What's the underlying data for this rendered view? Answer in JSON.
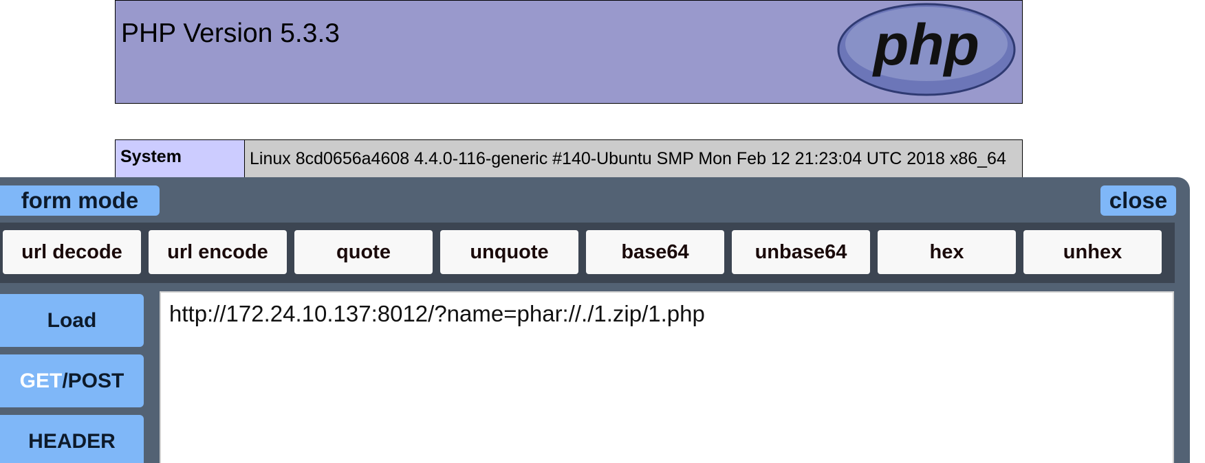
{
  "phpinfo": {
    "title": "PHP Version 5.3.3",
    "logo_text": "php",
    "system_label": "System",
    "system_value": "Linux 8cd0656a4608 4.4.0-116-generic #140-Ubuntu SMP Mon Feb 12 21:23:04 UTC 2018 x86_64"
  },
  "hackbar": {
    "form_mode_label": "form mode",
    "close_label": "close",
    "tools": [
      "url decode",
      "url encode",
      "quote",
      "unquote",
      "base64",
      "unbase64",
      "hex",
      "unhex"
    ],
    "load_label": "Load",
    "get_label": "GET",
    "post_label": "/POST",
    "header_label": "HEADER",
    "url_value": "http://172.24.10.137:8012/?name=phar://./1.zip/1.php"
  },
  "colors": {
    "php_header_bg": "#9999cc",
    "hackbar_bg": "#536274",
    "accent_button": "#7fb7f8"
  }
}
